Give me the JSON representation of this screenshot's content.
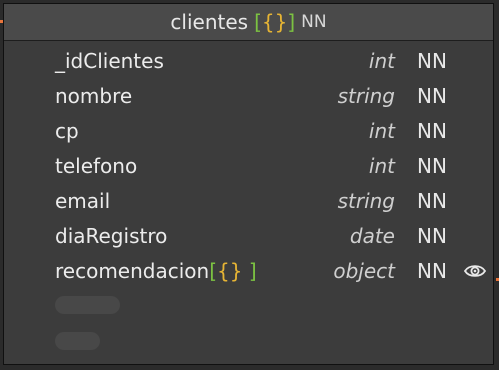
{
  "entity": {
    "name": "clientes",
    "type_bracket_open": "[",
    "type_brace": "{}",
    "type_bracket_close": "]",
    "nn": "NN"
  },
  "fields": [
    {
      "name": "_idClientes",
      "type": "int",
      "nn": "NN"
    },
    {
      "name": "nombre",
      "type": "string",
      "nn": "NN"
    },
    {
      "name": "cp",
      "type": "int",
      "nn": "NN"
    },
    {
      "name": "telefono",
      "type": "int",
      "nn": "NN"
    },
    {
      "name": "email",
      "type": "string",
      "nn": "NN"
    },
    {
      "name": "diaRegistro",
      "type": "date",
      "nn": "NN"
    },
    {
      "name": "recomendacion",
      "type": "object",
      "nn": "NN",
      "suffix_bracket_open": "[",
      "suffix_brace": "{}",
      "suffix_bracket_close": " ]",
      "icon": "eye-icon"
    }
  ],
  "colors": {
    "background": "#2b2b2b",
    "entity_body": "#3c3c3c",
    "entity_header": "#4a4a4a",
    "bracket": "#7cc242",
    "brace": "#e6b434",
    "edge_marker": "#e8743b"
  }
}
